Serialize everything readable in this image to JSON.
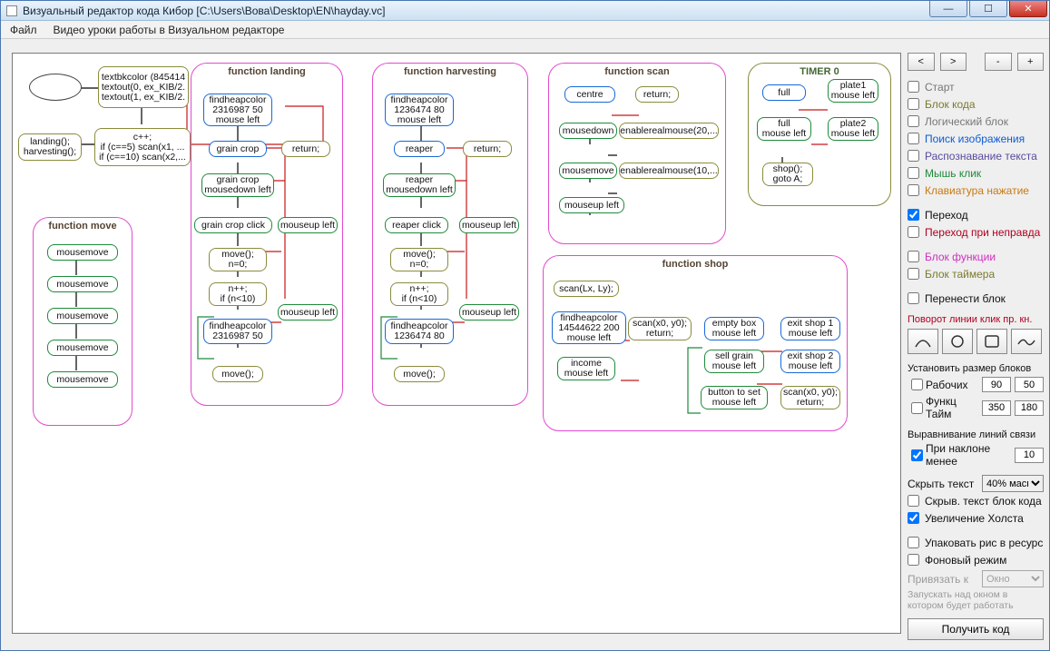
{
  "window": {
    "title": "Визуальный редактор кода Кибор  [C:\\Users\\Вова\\Desktop\\EN\\hayday.vc]"
  },
  "menu": {
    "file": "Файл",
    "video": "Видео уроки работы в Визуальном редакторе"
  },
  "nav": {
    "back": "<",
    "fwd": ">",
    "minus": "-",
    "plus": "+"
  },
  "types": {
    "start": "Старт",
    "code": "Блок кода",
    "logic": "Логический блок",
    "image": "Поиск изображения",
    "ocr": "Распознавание текста",
    "mouse": "Мышь клик",
    "keyb": "Клавиатура нажатие",
    "jump": "Переход",
    "jumpf": "Переход при неправда",
    "func": "Блок функции",
    "timer": "Блок таймера",
    "move": "Перенести блок"
  },
  "rot": "Поворот линии клик пр. кн.",
  "size": {
    "header": "Установить размер блоков",
    "work": "Рабочих",
    "work_w": "90",
    "work_h": "50",
    "func": "Функц Тайм",
    "func_w": "350",
    "func_h": "180"
  },
  "align": {
    "header": "Выравнивание линий связи",
    "slope": "При наклоне менее",
    "slope_v": "10"
  },
  "hide": {
    "label": "Скрыть текст",
    "value": "40% масш"
  },
  "opts2": {
    "hide_code": "Скрыв. текст блок кода",
    "zoom": "Увеличение Холста",
    "pack": "Упаковать рис в ресурс",
    "bg": "Фоновый режим"
  },
  "attach": {
    "label": "Привязать к",
    "value": "Окно"
  },
  "hint": "Запускать над окном в котором будет работать",
  "getcode": "Получить код",
  "groups": {
    "move": "function move",
    "landing": "function landing",
    "harvesting": "function harvesting",
    "scan": "function scan",
    "shop": "function shop",
    "timer0": "TIMER 0"
  },
  "top": {
    "textbk": "textbkcolor (845414\ntextout(0, ex_KIB/2.\ntextout(1, ex_KIB/2.",
    "calls": "landing();\nharvesting();",
    "loop": "c++;\nif (c==5) scan(x1, ...\nif (c==10) scan(x2,..."
  },
  "move_nodes": [
    "mousemove",
    "mousemove",
    "mousemove",
    "mousemove",
    "mousemove"
  ],
  "landing": {
    "find1": "findheapcolor\n2316987 50\nmouse left",
    "crop": "grain crop",
    "ret": "return;",
    "crop_md": "grain crop\nmousedown left",
    "crop_click": "grain crop click",
    "mu": "mouseup left",
    "mv1": "move();\nn=0;",
    "cond": "n++;\nif (n<10)",
    "mu2": "mouseup left",
    "find2": "findheapcolor\n2316987 50",
    "mv2": "move();"
  },
  "harvesting": {
    "find1": "findheapcolor\n1236474 80\nmouse left",
    "reap": "reaper",
    "ret": "return;",
    "reap_md": "reaper\nmousedown left",
    "reap_click": "reaper click",
    "mu": "mouseup left",
    "mv1": "move();\nn=0;",
    "cond": "n++;\nif (n<10)",
    "mu2": "mouseup left",
    "find2": "findheapcolor\n1236474 80",
    "mv2": "move();"
  },
  "scan": {
    "centre": "centre",
    "ret": "return;",
    "md": "mousedown",
    "er1": "enablerealmouse(20,...",
    "mm": "mousemove",
    "er2": "enablerealmouse(10,...",
    "mu": "mouseup left"
  },
  "shop": {
    "scanL": "scan(Lx, Ly);",
    "find": "findheapcolor\n14544622 200\nmouse left",
    "scan0": "scan(x0, y0);\nreturn;",
    "inc": "income\nmouse left",
    "empty": "empty box\nmouse left",
    "sell": "sell grain\nmouse left",
    "setp": "button to set\nmouse left",
    "exit1": "exit shop 1\nmouse left",
    "exit2": "exit shop 2\nmouse left",
    "scan1": "scan(x0, y0);\nreturn;"
  },
  "timer": {
    "full": "full",
    "full_ml": "full\nmouse left",
    "plate1": "plate1\nmouse left",
    "plate2": "plate2\nmouse left",
    "shop": "shop();\ngoto A;"
  }
}
